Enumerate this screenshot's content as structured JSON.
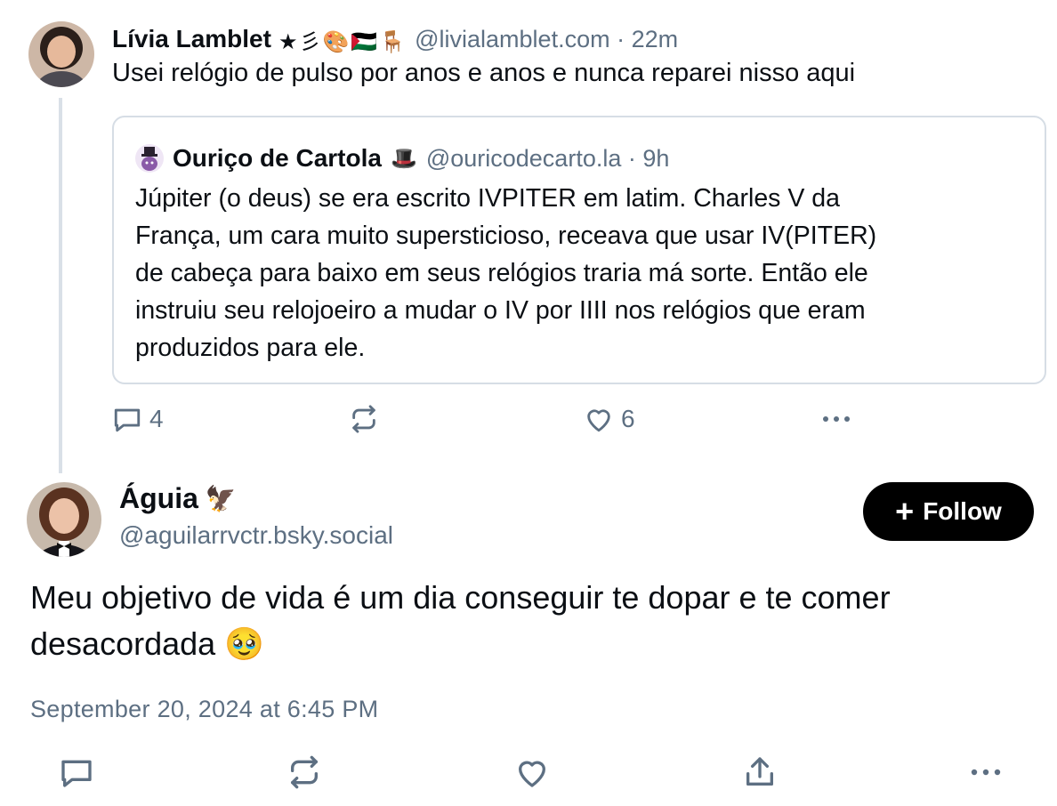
{
  "parent_post": {
    "author_name": "Lívia Lamblet",
    "author_emojis": "★彡🎨🇵🇸🪑",
    "handle": "@livialamblet.com",
    "time": "22m",
    "text": "Usei relógio de pulso por anos e anos e nunca reparei nisso aqui",
    "quote": {
      "author_name": "Ouriço de Cartola",
      "author_emoji": "🎩",
      "handle": "@ouricodecarto.la",
      "time": "9h",
      "lines": [
        "Júpiter (o deus) se era escrito  IVPITER em latim. Charles V da",
        "França, um cara muito supersticioso, receava que usar IV(PITER)",
        "de cabeça para baixo em seus relógios traria má sorte.  Então ele",
        "instruiu seu relojoeiro a mudar o IV por IIII nos relógios que eram",
        "produzidos para ele."
      ]
    },
    "actions": {
      "reply_count": "4",
      "like_count": "6",
      "icons": [
        "reply-icon",
        "repost-icon",
        "like-icon",
        "more-icon"
      ]
    }
  },
  "main_post": {
    "author_name": "Águia",
    "author_emoji": "🦅",
    "handle": "@aguilarrvctr.bsky.social",
    "follow_label": "Follow",
    "text_lines": [
      "Meu objetivo de vida é um dia conseguir te dopar e te comer",
      "desacordada 🥹"
    ],
    "date": "September 20, 2024 at 6:45 PM",
    "actions": {
      "icons": [
        "reply-icon",
        "repost-icon",
        "like-icon",
        "share-icon",
        "more-icon"
      ]
    }
  },
  "colors": {
    "text": "#0b0f14",
    "muted": "#5d6f82",
    "border": "#d6dde5",
    "follow_bg": "#000000"
  }
}
